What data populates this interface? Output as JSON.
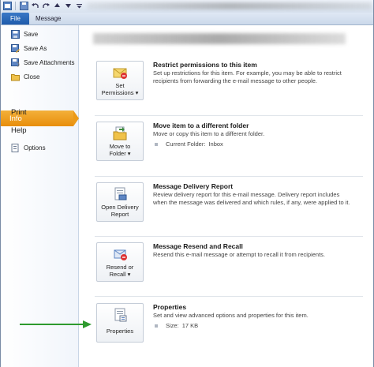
{
  "ribbon": {
    "tabs": [
      {
        "label": "File"
      },
      {
        "label": "Message"
      }
    ]
  },
  "nav": {
    "items": [
      {
        "label": "Save",
        "icon": "save-icon"
      },
      {
        "label": "Save As",
        "icon": "save-as-icon"
      },
      {
        "label": "Save Attachments",
        "icon": "save-attachments-icon"
      },
      {
        "label": "Close",
        "icon": "close-folder-icon"
      }
    ],
    "info": "Info",
    "print": "Print",
    "help": "Help",
    "options": "Options"
  },
  "sections": [
    {
      "button_lines": [
        "Set",
        "Permissions ▾"
      ],
      "title": "Restrict permissions to this item",
      "description": "Set up restrictions for this item. For example, you may be able to restrict recipients from forwarding the e-mail message to other people."
    },
    {
      "button_lines": [
        "Move to",
        "Folder ▾"
      ],
      "title": "Move item to a different folder",
      "description": "Move or copy this item to a different folder.",
      "bullet": {
        "key": "Current Folder:",
        "value": "Inbox"
      }
    },
    {
      "button_lines": [
        "Open Delivery",
        "Report"
      ],
      "title": "Message Delivery Report",
      "description": "Review delivery report for this e-mail message. Delivery report includes when the message was delivered and which rules, if any, were applied to it."
    },
    {
      "button_lines": [
        "Resend or",
        "Recall ▾"
      ],
      "title": "Message Resend and Recall",
      "description": "Resend this e-mail message or attempt to recall it from recipients."
    },
    {
      "button_lines": [
        "Properties"
      ],
      "title": "Properties",
      "description": "Set and view advanced options and properties for this item.",
      "bullet": {
        "key": "Size:",
        "value": "17 KB"
      }
    }
  ],
  "colors": {
    "file_tab": "#2a68b8",
    "info_highlight": "#ec9a18",
    "annotation_arrow": "#2e9a2e"
  }
}
